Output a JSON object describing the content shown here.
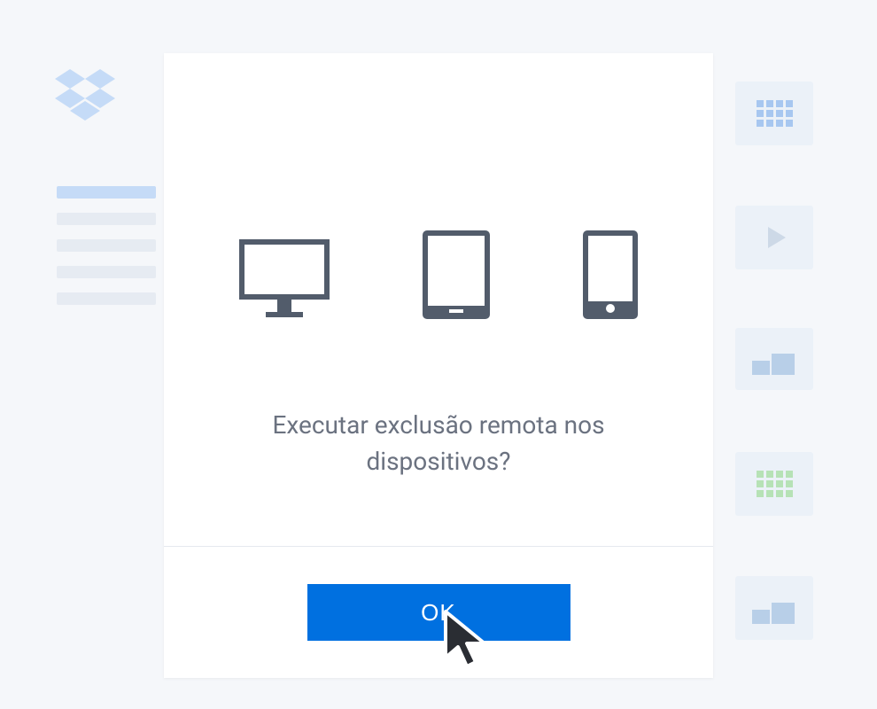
{
  "modal": {
    "question": "Executar exclusão remota nos dispositivos?",
    "ok_label": "OK"
  },
  "icons": {
    "dropbox": "dropbox-logo",
    "monitor": "monitor",
    "tablet": "tablet",
    "phone": "phone"
  },
  "bg_tiles": {
    "t1": "grid-blue",
    "t2": "play",
    "t3": "folder-building",
    "t4": "grid-green",
    "t5": "folder-building"
  }
}
